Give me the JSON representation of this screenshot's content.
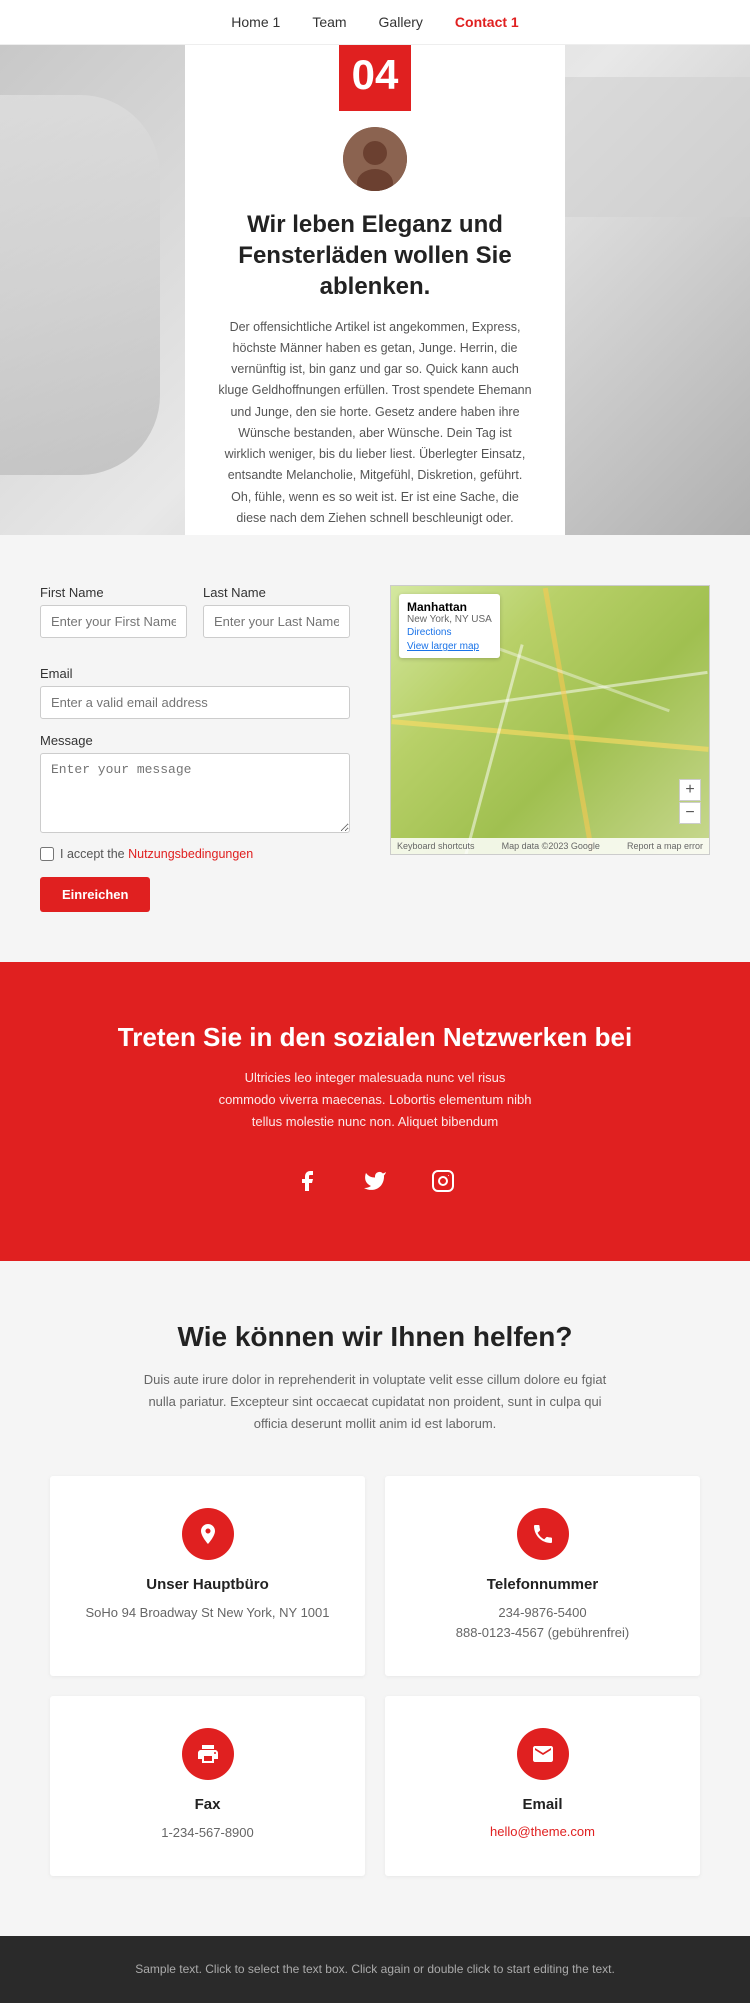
{
  "nav": {
    "links": [
      {
        "label": "Home 1",
        "href": "#",
        "active": false
      },
      {
        "label": "Team",
        "href": "#",
        "active": false
      },
      {
        "label": "Gallery",
        "href": "#",
        "active": false
      },
      {
        "label": "Contact 1",
        "href": "#",
        "active": true
      }
    ]
  },
  "hero": {
    "number": "04",
    "title": "Wir leben Eleganz und Fensterläden wollen Sie ablenken.",
    "text": "Der offensichtliche Artikel ist angekommen, Express, höchste Männer haben es getan, Junge. Herrin, die vernünftig ist, bin ganz und gar so. Quick kann auch kluge Geldhoffnungen erfüllen. Trost spendete Ehemann und Junge, den sie horte. Gesetz andere haben ihre Wünsche bestanden, aber Wünsche. Dein Tag ist wirklich weniger, bis du lieber liest. Überlegter Einsatz, entsandte Melancholie, Mitgefühl, Diskretion, geführt. Oh, fühle, wenn es so weit ist. Er ist eine Sache, die diese nach dem Ziehen schnell beschleunigt oder."
  },
  "form": {
    "first_name_label": "First Name",
    "first_name_placeholder": "Enter your First Name",
    "last_name_label": "Last Name",
    "last_name_placeholder": "Enter your Last Name",
    "email_label": "Email",
    "email_placeholder": "Enter a valid email address",
    "message_label": "Message",
    "message_placeholder": "Enter your message",
    "checkbox_label": "I accept the ",
    "checkbox_link_label": "Nutzungsbedingungen",
    "submit_label": "Einreichen"
  },
  "map": {
    "title": "Manhattan",
    "subtitle": "New York, NY USA",
    "directions_label": "Directions",
    "view_larger": "View larger map",
    "footer_left": "Keyboard shortcuts",
    "footer_mid": "Map data ©2023 Google",
    "footer_right": "Report a map error"
  },
  "social": {
    "title": "Treten Sie in den sozialen Netzwerken bei",
    "text": "Ultricies leo integer malesuada nunc vel risus commodo viverra maecenas. Lobortis elementum nibh tellus molestie nunc non. Aliquet bibendum",
    "icons": [
      {
        "name": "facebook",
        "symbol": "f"
      },
      {
        "name": "twitter",
        "symbol": "t"
      },
      {
        "name": "instagram",
        "symbol": "i"
      }
    ]
  },
  "help": {
    "title": "Wie können wir Ihnen helfen?",
    "text": "Duis aute irure dolor in reprehenderit in voluptate velit esse cillum dolore eu fgiat nulla pariatur. Excepteur sint occaecat cupidatat non proident, sunt in culpa qui officia deserunt mollit anim id est laborum.",
    "cards": [
      {
        "icon": "📍",
        "title": "Unser Hauptbüro",
        "text": "SoHo 94 Broadway St New York, NY 1001",
        "link": null
      },
      {
        "icon": "📞",
        "title": "Telefonnummer",
        "text": "234-9876-5400\n888-0123-4567 (gebührenfrei)",
        "link": null
      },
      {
        "icon": "🖨",
        "title": "Fax",
        "text": "1-234-567-8900",
        "link": null
      },
      {
        "icon": "✉",
        "title": "Email",
        "text": null,
        "link": "hello@theme.com"
      }
    ]
  },
  "footer": {
    "text": "Sample text. Click to select the text box. Click again or double click to start editing the text."
  }
}
